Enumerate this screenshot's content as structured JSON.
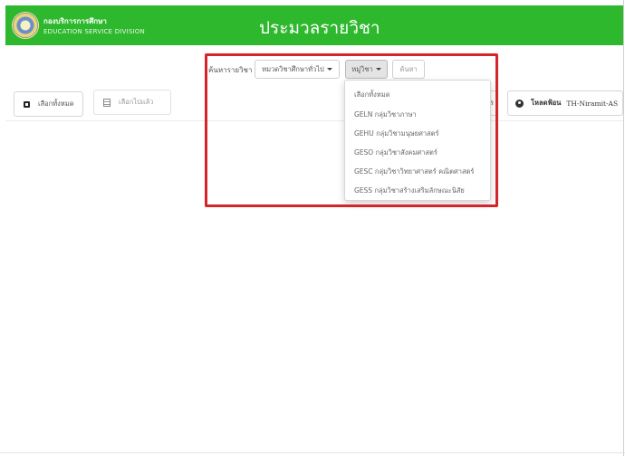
{
  "header": {
    "org_name": "กองบริการการศึกษา",
    "org_sub": "EDUCATION SERVICE DIVISION",
    "title": "ประมวลรายวิชา",
    "colors": {
      "header_bg": "#2eb82e",
      "highlight": "#d6242b"
    }
  },
  "search": {
    "label": "ค้นหารายวิชา",
    "category_value": "หมวดวิชาศึกษาทั่วไป",
    "group_value": "หมู่วิชา",
    "search_placeholder": "ค้นหา"
  },
  "toolbar": {
    "select_all_label": "เลือกทั้งหมด",
    "selected_label": "เลือกไปแล้ว",
    "hidden_fragment": "ร",
    "download_label": "โหลดฟ้อน",
    "download_font": "TH-Niramit-AS"
  },
  "dropdown": {
    "items": [
      "เลือกทั้งหมด",
      "GELN กลุ่มวิชาภาษา",
      "GEHU กลุ่มวิชามนุษยศาสตร์",
      "GESO กลุ่มวิชาสังคมศาสตร์",
      "GESC กลุ่มวิชาวิทยาศาสตร์ คณิตศาสตร์",
      "GESS กลุ่มวิชาสร้างเสริมลักษณะนิสัย"
    ]
  },
  "icons": {
    "select_all": "checkbox-square-icon",
    "selected": "list-icon",
    "download": "download-circle-icon",
    "caret": "caret-down-icon"
  }
}
